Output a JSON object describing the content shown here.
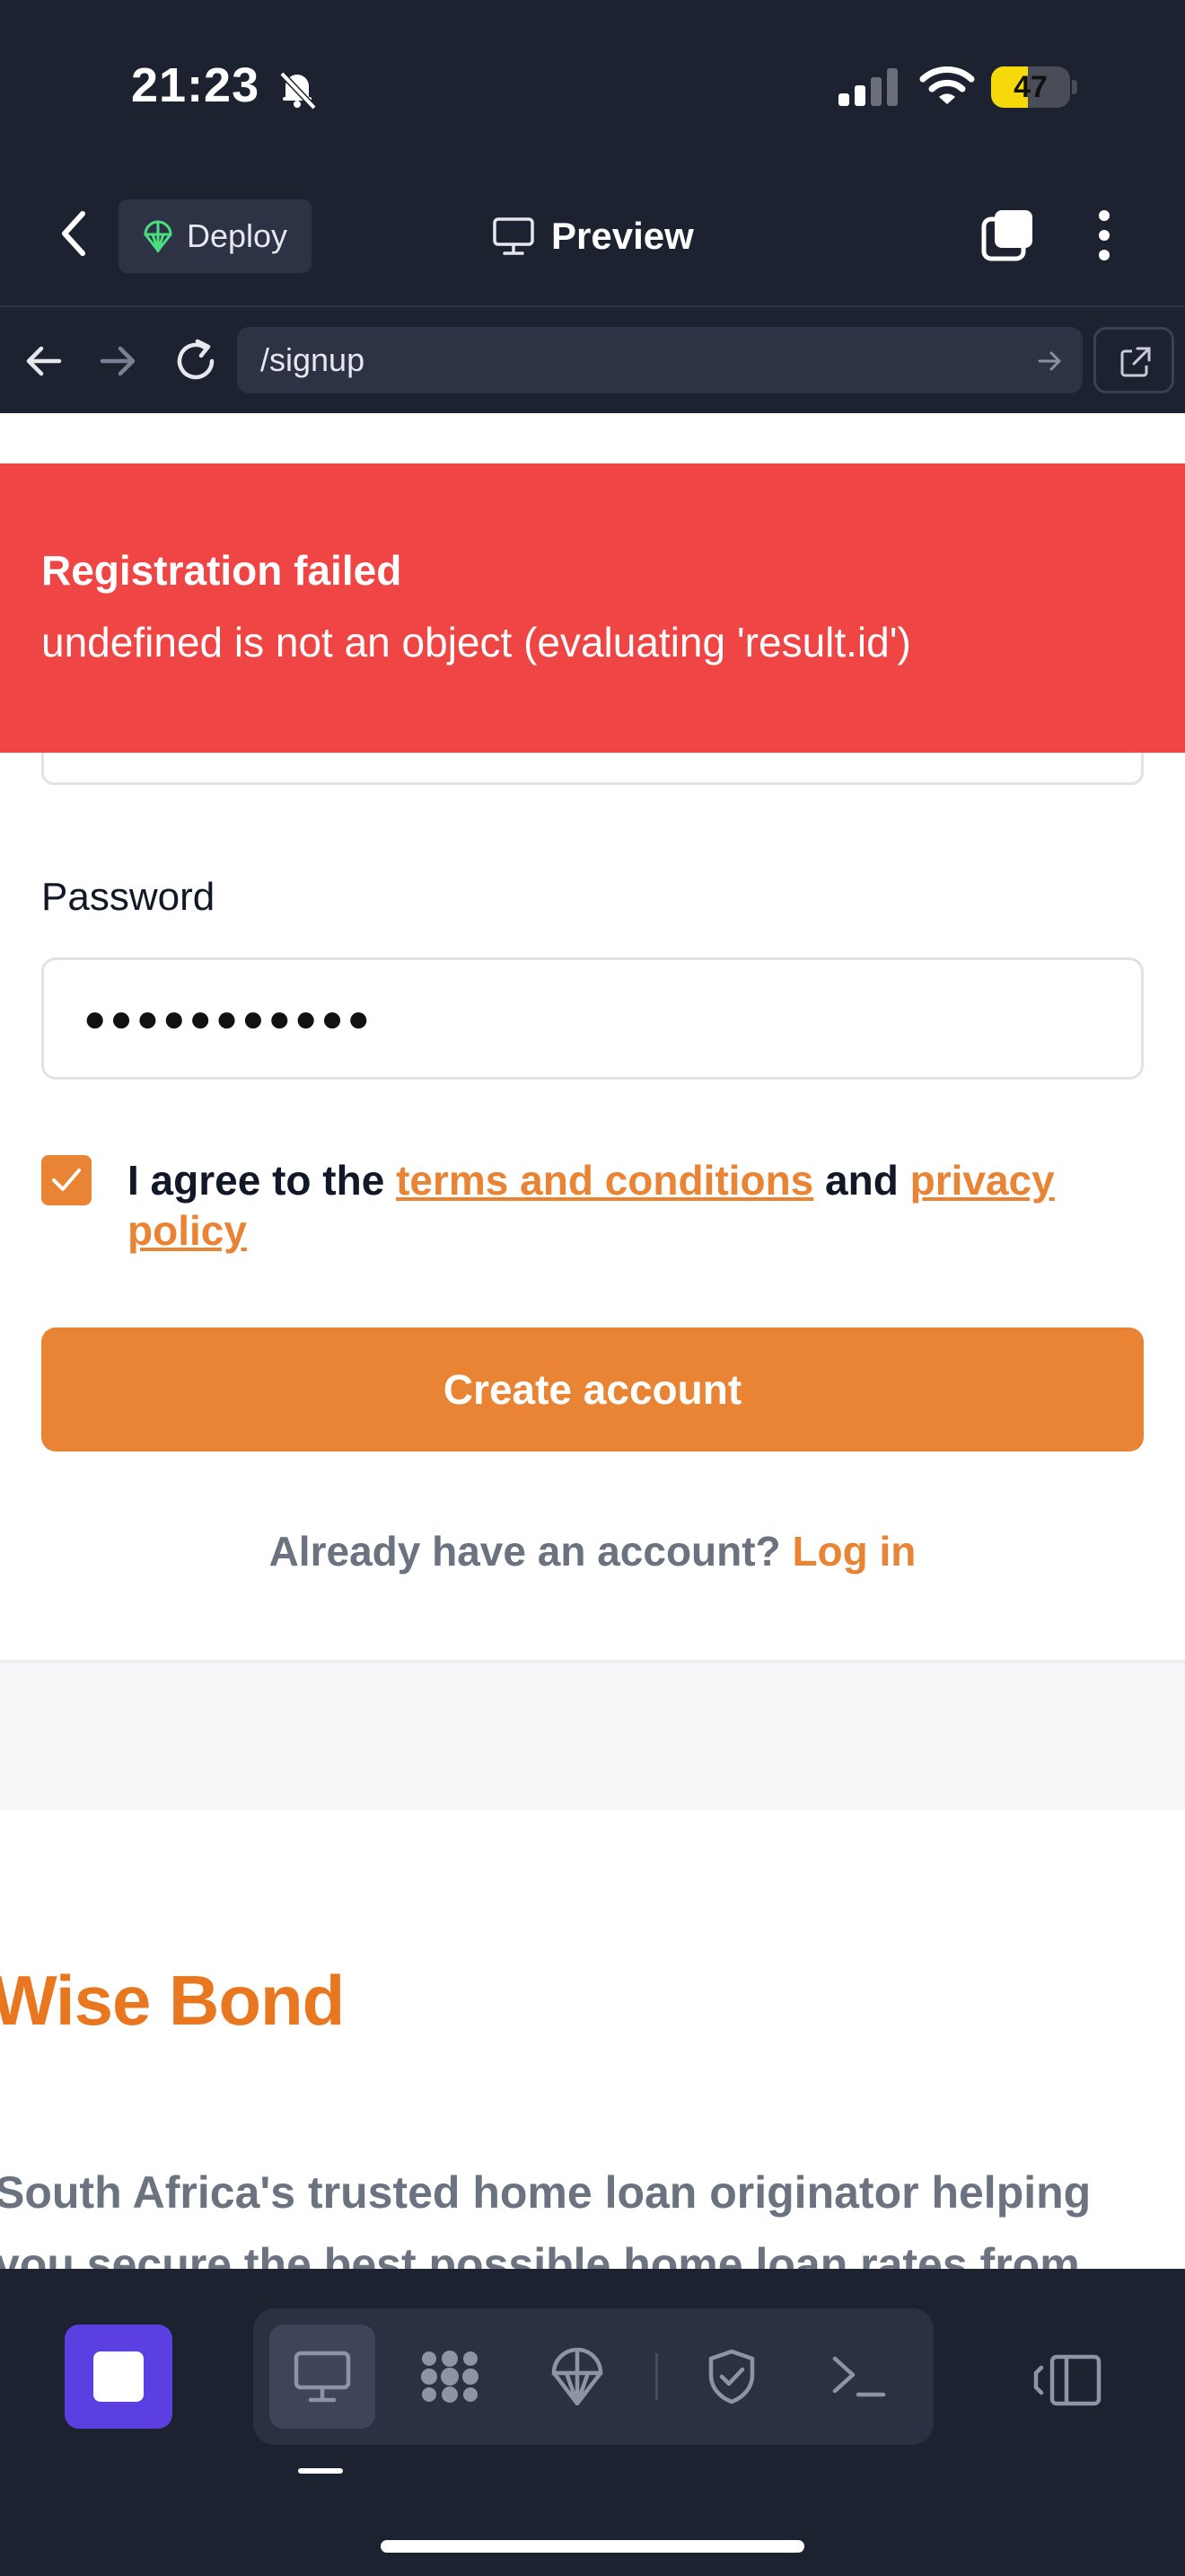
{
  "status_bar": {
    "time": "21:23",
    "battery_percent": "47",
    "battery_level": 0.47,
    "icons": [
      "bell-slash-icon",
      "signal-icon",
      "wifi-icon",
      "battery-icon"
    ]
  },
  "header": {
    "deploy_label": "Deploy",
    "preview_label": "Preview",
    "icons": [
      "chevron-left-icon",
      "deploy-icon",
      "monitor-icon",
      "tabs-icon",
      "more-vertical-icon"
    ]
  },
  "browser": {
    "url": "/signup",
    "icons": [
      "arrow-left-icon",
      "arrow-right-icon",
      "reload-icon",
      "go-arrow-icon",
      "external-link-icon"
    ]
  },
  "toast": {
    "title": "Registration failed",
    "message": "undefined is not an object (evaluating 'result.id')",
    "color": "#ef4545"
  },
  "form": {
    "password_label": "Password",
    "password_value": "●●●●●●●●●●●",
    "agree_prefix": "I agree to the",
    "terms_link": "terms and conditions",
    "agree_and": "and",
    "privacy_link": "privacy policy",
    "terms_checked": true,
    "submit_label": "Create account",
    "login_prompt": "Already have an account?",
    "login_link": "Log in",
    "accent": "#e88434"
  },
  "footer_section": {
    "brand": "Wise Bond",
    "description_line1": "South Africa's trusted home loan originator helping",
    "description_line2": "you secure the best possible home loan rates from"
  },
  "toolbar": {
    "icons": [
      "stop-icon",
      "desktop-icon",
      "apps-icon",
      "deploy-icon",
      "shield-check-icon",
      "terminal-icon",
      "panel-toggle-icon"
    ],
    "active_tool": "desktop"
  }
}
